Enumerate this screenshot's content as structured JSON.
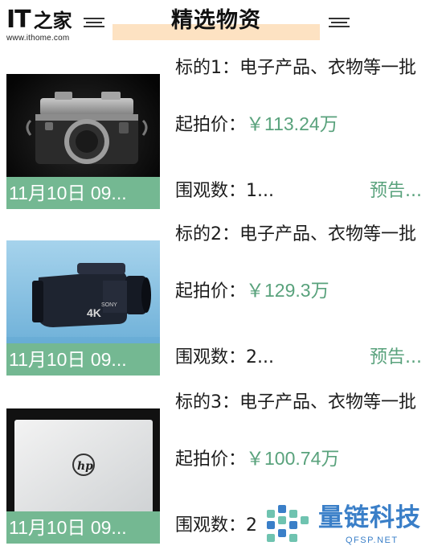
{
  "header": {
    "logo_main": "IT",
    "logo_side": "之家",
    "logo_url": "www.ithome.com",
    "title": "精选物资"
  },
  "items": [
    {
      "title": "标的1：电子产品、衣物等一批",
      "price_label": "起拍价：",
      "price_value": "￥113.24万",
      "watch_label": "围观数：",
      "watch_value": "1...",
      "status": "预告...",
      "date": "11月10日 09...",
      "image": "camera-image"
    },
    {
      "title": "标的2：电子产品、衣物等一批",
      "price_label": "起拍价：",
      "price_value": "￥129.3万",
      "watch_label": "围观数：",
      "watch_value": "2...",
      "status": "预告...",
      "date": "11月10日 09...",
      "image": "camcorder-image"
    },
    {
      "title": "标的3：电子产品、衣物等一批",
      "price_label": "起拍价：",
      "price_value": "￥100.74万",
      "watch_label": "围观数：",
      "watch_value": "2",
      "status": "",
      "date": "11月10日 09...",
      "image": "laptop-image"
    }
  ],
  "watermark": {
    "name": "量链科技",
    "domain": "QFSP.NET"
  },
  "colors": {
    "accent_green": "#59a27c",
    "date_bar": "#74b892",
    "title_highlight": "#fde2c2",
    "watermark_blue": "#3a7fc8"
  }
}
